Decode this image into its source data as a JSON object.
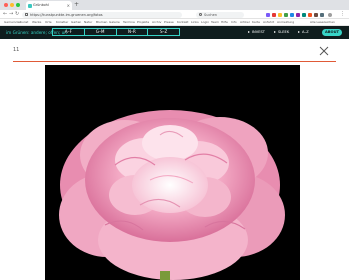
{
  "browser": {
    "tab_title": "Grünkohl",
    "url": "https://kunstpunkte-im-gruenen.org/fotos",
    "search_placeholder": "Suchen",
    "bookmarks": [
      "Gemeinden",
      "Kunst",
      "Werke",
      "Orte",
      "Künstler",
      "Garten",
      "Natur",
      "Blumen",
      "Galerie",
      "Termine",
      "Projekte",
      "Archiv",
      "Presse",
      "Kontakt",
      "Links",
      "Login",
      "Team",
      "Hilfe",
      "Info",
      "Artikel",
      "Karte",
      "Anfahrt",
      "Anmeldung",
      "Alle Lesezeichen"
    ]
  },
  "site": {
    "brand": "im Grünen: andere; offen; un",
    "letter_ranges": [
      "A–F",
      "G–M",
      "N–R",
      "S–Z"
    ],
    "buttons": {
      "invest": "INVEST",
      "sleek": "SLEEK",
      "az": "A–Z",
      "about": "ABOUT"
    }
  },
  "detail": {
    "counter": "11"
  },
  "colors": {
    "accent": "#37d4c7",
    "nav_bg": "#0f1d1e",
    "divider": "#e05a37"
  },
  "icons": {
    "close": "close-icon",
    "play": "play-icon",
    "lock": "lock-icon",
    "search": "search-icon"
  },
  "photo": {
    "subject": "pink peony flower",
    "background": "#000000"
  }
}
